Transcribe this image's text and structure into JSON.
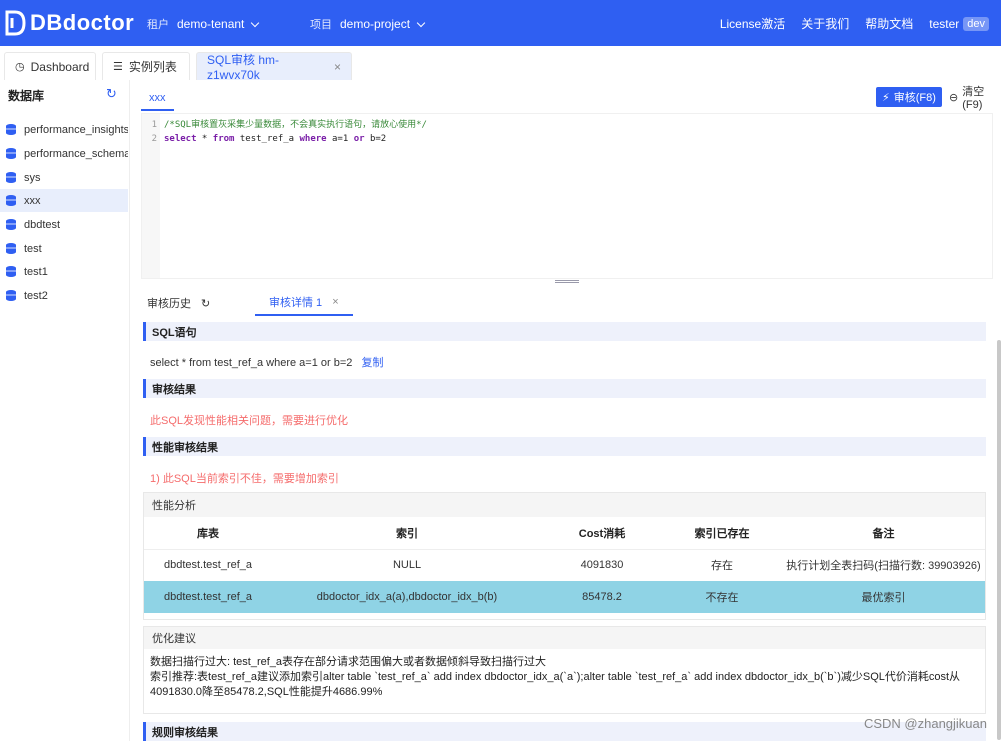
{
  "header": {
    "logo_text": "DBdoctor",
    "tenant_label": "租户",
    "tenant_value": "demo-tenant",
    "project_label": "项目",
    "project_value": "demo-project",
    "nav": [
      "License激活",
      "关于我们",
      "帮助文档"
    ],
    "user_name": "tester",
    "user_badge": "dev",
    "brand_color": "#2f5ff2"
  },
  "tabs": [
    {
      "label": "Dashboard",
      "icon": "dashboard-icon"
    },
    {
      "label": "实例列表",
      "icon": "list-icon"
    },
    {
      "label": "SQL审核 hm-z1wvx70k",
      "icon": "close-icon",
      "active": true
    }
  ],
  "sidebar": {
    "title": "数据库",
    "items": [
      {
        "label": "performance_insights..."
      },
      {
        "label": "performance_schema..."
      },
      {
        "label": "sys"
      },
      {
        "label": "xxx",
        "selected": true
      },
      {
        "label": "dbdtest"
      },
      {
        "label": "test"
      },
      {
        "label": "test1"
      },
      {
        "label": "test2"
      }
    ]
  },
  "editor": {
    "tab_label": "xxx",
    "audit_button": "审核(F8)",
    "clear_button": "清空(F9)",
    "line_numbers": [
      "1",
      "2"
    ],
    "line1": "/*SQL审核置灰采集少量数据，不会真实执行语句，请放心使用*/",
    "line2_kw1": "select",
    "line2_a": " * ",
    "line2_kw2": "from",
    "line2_b": " test_ref_a ",
    "line2_kw3": "where",
    "line2_c": " a=1 ",
    "line2_kw4": "or",
    "line2_d": " b=2"
  },
  "result": {
    "tab_history": "审核历史",
    "tab_detail": "审核详情 1",
    "sql_title": "SQL语句",
    "sql_text": "select * from test_ref_a where a=1 or b=2",
    "copy_label": "复制",
    "audit_result_title": "审核结果",
    "audit_result_text": "此SQL发现性能相关问题，需要进行优化",
    "perf_result_title": "性能审核结果",
    "perf_result_text": "1) 此SQL当前索引不佳，需要增加索引",
    "perf_analysis_title": "性能分析",
    "columns": [
      "库表",
      "索引",
      "Cost消耗",
      "索引已存在",
      "备注"
    ],
    "rows": [
      [
        "dbdtest.test_ref_a",
        "NULL",
        "4091830",
        "存在",
        "执行计划全表扫码(扫描行数: 39903926)"
      ],
      [
        "dbdtest.test_ref_a",
        "dbdoctor_idx_a(a),dbdoctor_idx_b(b)",
        "85478.2",
        "不存在",
        "最优索引"
      ]
    ],
    "advise_title": "优化建议",
    "advise_line1": "数据扫描行过大: test_ref_a表存在部分请求范围偏大或者数据倾斜导致扫描行过大",
    "advise_line2": "索引推荐:表test_ref_a建议添加索引alter table `test_ref_a` add index dbdoctor_idx_a(`a`);alter table `test_ref_a` add index dbdoctor_idx_b(`b`)减少SQL代价消耗cost从",
    "advise_line3": "4091830.0降至85478.2,SQL性能提升4686.99%",
    "rule_result_title": "规则审核结果"
  },
  "watermark": "CSDN @zhangjikuan"
}
